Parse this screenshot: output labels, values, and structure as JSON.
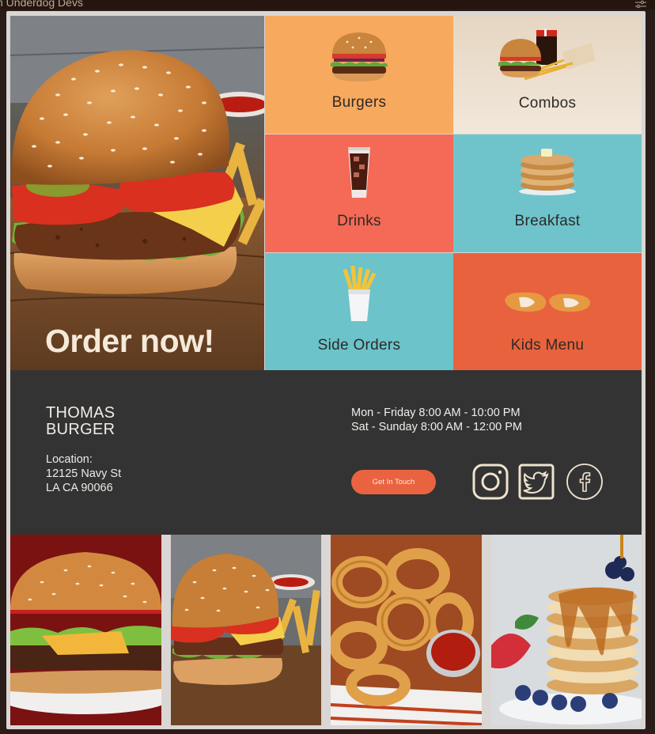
{
  "window": {
    "title": "h Underdog Devs",
    "settings_icon": "sliders-icon"
  },
  "hero": {
    "headline": "Order now!",
    "image": "burger-photo"
  },
  "menu": {
    "tiles": [
      {
        "label": "Burgers",
        "icon": "burger-icon",
        "color": "#f7a95e"
      },
      {
        "label": "Combos",
        "icon": "combo-meal-icon",
        "color": "#ede1d1"
      },
      {
        "label": "Drinks",
        "icon": "soda-cup-icon",
        "color": "#f46a56"
      },
      {
        "label": "Breakfast",
        "icon": "pancakes-icon",
        "color": "#6fc4cb"
      },
      {
        "label": "Side Orders",
        "icon": "fries-icon",
        "color": "#6cc3ca"
      },
      {
        "label": "Kids Menu",
        "icon": "chicken-nuggets-icon",
        "color": "#e9623e"
      }
    ]
  },
  "info": {
    "brand_line1": "THOMAS",
    "brand_line2": "BURGER",
    "location_label": "Location:",
    "address_line1": "12125 Navy St",
    "address_line2": "LA CA 90066",
    "hours_line1": "Mon - Friday 8:00 AM - 10:00 PM",
    "hours_line2": "Sat - Sunday 8:00 AM - 12:00 PM",
    "cta_label": "Get In Touch",
    "social": [
      "instagram-icon",
      "twitter-icon",
      "facebook-icon"
    ],
    "background": "#333333",
    "accent": "#ea6340"
  },
  "gallery": {
    "images": [
      "burger-on-plate-photo",
      "burger-with-fries-photo",
      "onion-rings-photo",
      "pancakes-photo"
    ]
  }
}
